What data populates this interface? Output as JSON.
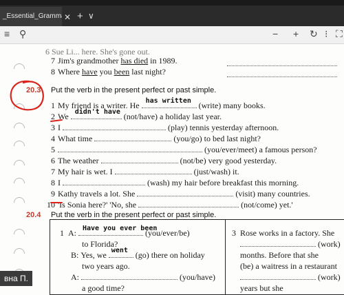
{
  "browser": {
    "tab_title": "_Essential_Grammar",
    "close_glyph": "✕",
    "new_tab_glyph": "+",
    "menu_glyph": "∨"
  },
  "toolbar": {
    "menu_icon": "≡",
    "search_icon": "⚲",
    "minus": "−",
    "plus": "+",
    "rotate_icon": "↻",
    "more_icon": "⁝",
    "fit_icon": "⛶"
  },
  "exercise_top": {
    "line6_fragment": "6  Sue Li... here. She's gone out.",
    "line7_num": "7",
    "line7_a": "Jim's grandmother ",
    "line7_b": "has died",
    "line7_c": " in 1989.",
    "line8_num": "8",
    "line8_a": "Where ",
    "line8_b": "have",
    "line8_c": " you ",
    "line8_d": "been",
    "line8_e": " last night?"
  },
  "section_20_3": {
    "number": "20.3",
    "title": "Put the verb in the present perfect or past simple.",
    "items": [
      {
        "n": "1",
        "pre": "My friend is a writer. He ",
        "answer": "has written",
        "post": " (write) many books."
      },
      {
        "n": "2",
        "pre": "We ",
        "answer": "didn't have",
        "post": " (not/have) a holiday last year."
      },
      {
        "n": "3",
        "pre": "I ",
        "answer": "",
        "post": " (play) tennis yesterday afternoon."
      },
      {
        "n": "4",
        "pre": "What time ",
        "answer": "",
        "post": " (you/go) to bed last night?"
      },
      {
        "n": "5",
        "pre": "",
        "answer": "",
        "post": " (you/ever/meet) a famous person?"
      },
      {
        "n": "6",
        "pre": "The weather ",
        "answer": "",
        "post": " (not/be) very good yesterday."
      },
      {
        "n": "7",
        "pre": "My hair is wet. I ",
        "answer": "",
        "post": " (just/wash) it."
      },
      {
        "n": "8",
        "pre": "I ",
        "answer": "",
        "post": " (wash) my hair before breakfast this morning."
      },
      {
        "n": "9",
        "pre": "Kathy travels a lot. She ",
        "answer": "",
        "post": " (visit) many countries."
      },
      {
        "n": "10",
        "pre": "'Is Sonia here?'  'No, she ",
        "answer": "",
        "post": " (not/come) yet.'"
      }
    ]
  },
  "section_20_4": {
    "number": "20.4",
    "title": "Put the verb in the present perfect or past simple.",
    "left": {
      "n": "1",
      "a_label": "A:",
      "a_answer": "Have you ever been",
      "a_post": " (you/ever/be)",
      "a_line2": "to Florida?",
      "b_label": "B:",
      "b_pre": "Yes, we ",
      "b_answer": "went",
      "b_post": " (go) there on holiday",
      "b_line2": "two years ago.",
      "a2_label": "A:",
      "a2_post": " (you/have)",
      "a2_line2": "a good time?"
    },
    "right": {
      "n": "3",
      "line1": "Rose works in a factory. She",
      "line2_post": " (work)",
      "line3": "months. Before that she",
      "line4": "(be) a waitress in a restaurant",
      "line5_post": " (work)",
      "line6": "years but she"
    }
  },
  "overlay": {
    "name_tag": "вна П."
  },
  "colors": {
    "section_red": "#c23b2e",
    "ink_red": "#d9231c"
  }
}
